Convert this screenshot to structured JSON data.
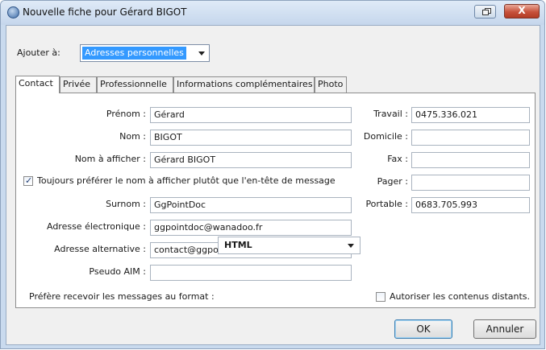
{
  "window": {
    "title": "Nouvelle fiche pour Gérard BIGOT",
    "close_label": "X"
  },
  "addressbook": {
    "label": "Ajouter à:",
    "value": "Adresses personnelles"
  },
  "tabs": [
    {
      "label": "Contact",
      "active": true
    },
    {
      "label": "Privée"
    },
    {
      "label": "Professionnelle"
    },
    {
      "label": "Informations complémentaires"
    },
    {
      "label": "Photo"
    }
  ],
  "contact": {
    "prenom_label": "Prénom :",
    "prenom_value": "Gérard",
    "nom_label": "Nom :",
    "nom_value": "BIGOT",
    "display_label": "Nom à afficher :",
    "display_value": "Gérard BIGOT",
    "prefer_display_label": "Toujours préférer le nom à afficher plutôt que l'en-tête de message",
    "prefer_display_checked": true,
    "surnom_label": "Surnom :",
    "surnom_value": "GgPointDoc",
    "email_label": "Adresse électronique :",
    "email_value": "ggpointdoc@wanadoo.fr",
    "alt_email_label": "Adresse alternative :",
    "alt_email_value": "contact@ggpointdoc.fr",
    "aim_label": "Pseudo AIM :",
    "aim_value": "",
    "format_label": "Préfère recevoir les messages au format :",
    "format_value": "HTML",
    "remote_label": "Autoriser les contenus distants.",
    "remote_checked": false
  },
  "phones": {
    "travail_label": "Travail :",
    "travail_value": "0475.336.021",
    "domicile_label": "Domicile :",
    "domicile_value": "",
    "fax_label": "Fax :",
    "fax_value": "",
    "pager_label": "Pager :",
    "pager_value": "",
    "portable_label": "Portable :",
    "portable_value": "0683.705.993"
  },
  "buttons": {
    "ok": "OK",
    "cancel": "Annuler"
  },
  "colors": {
    "selection": "#3399ff",
    "window_frame": "#c9daee",
    "close_button": "#c7513b"
  }
}
